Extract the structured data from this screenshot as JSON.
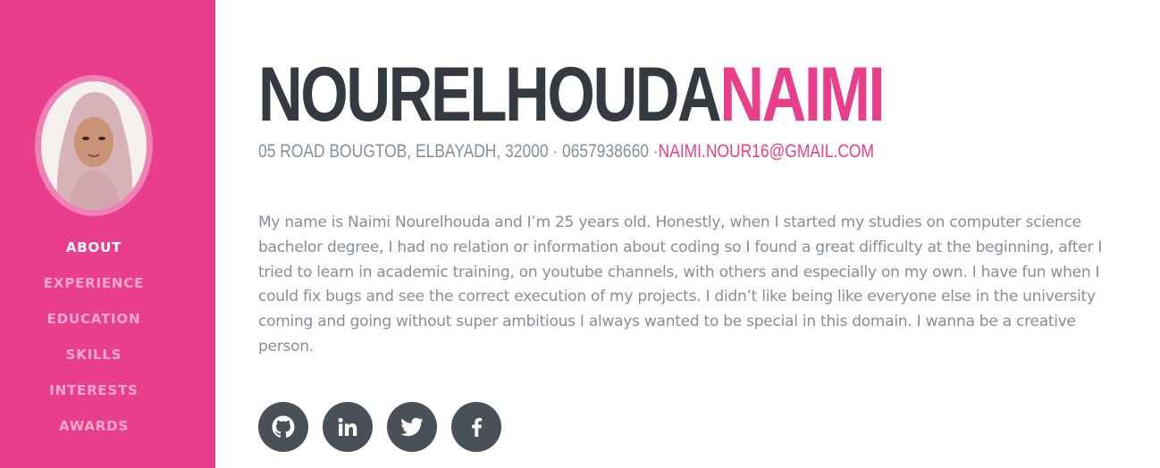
{
  "profile": {
    "first_name": "NOURELHOUDA",
    "last_name": "NAIMI",
    "address_phone": "05 ROAD BOUGTOB, ELBAYADH, 32000 · 0657938660 ·",
    "email": "NAIMI.NOUR16@GMAIL.COM",
    "bio": "My name is Naimi Nourelhouda and I’m 25 years old. Honestly, when I started my studies on computer science bachelor degree, I had no relation or information about coding so I found a great difficulty at the beginning, after I tried to learn in academic training, on youtube channels, with others and especially on my own. I have fun when I could fix bugs and see the correct execution of my projects. I didn’t like being like everyone else in the university coming and going without super ambitious I always wanted to be special in this domain. I wanna be a creative person."
  },
  "nav": {
    "items": [
      {
        "label": "ABOUT",
        "active": true
      },
      {
        "label": "EXPERIENCE",
        "active": false
      },
      {
        "label": "EDUCATION",
        "active": false
      },
      {
        "label": "SKILLS",
        "active": false
      },
      {
        "label": "INTERESTS",
        "active": false
      },
      {
        "label": "AWARDS",
        "active": false
      }
    ]
  },
  "social": {
    "icons": [
      "github-icon",
      "linkedin-icon",
      "twitter-icon",
      "facebook-icon"
    ]
  },
  "colors": {
    "accent": "#e83e8c",
    "heading": "#343a40",
    "text": "#868e96",
    "social_bg": "#495057"
  }
}
